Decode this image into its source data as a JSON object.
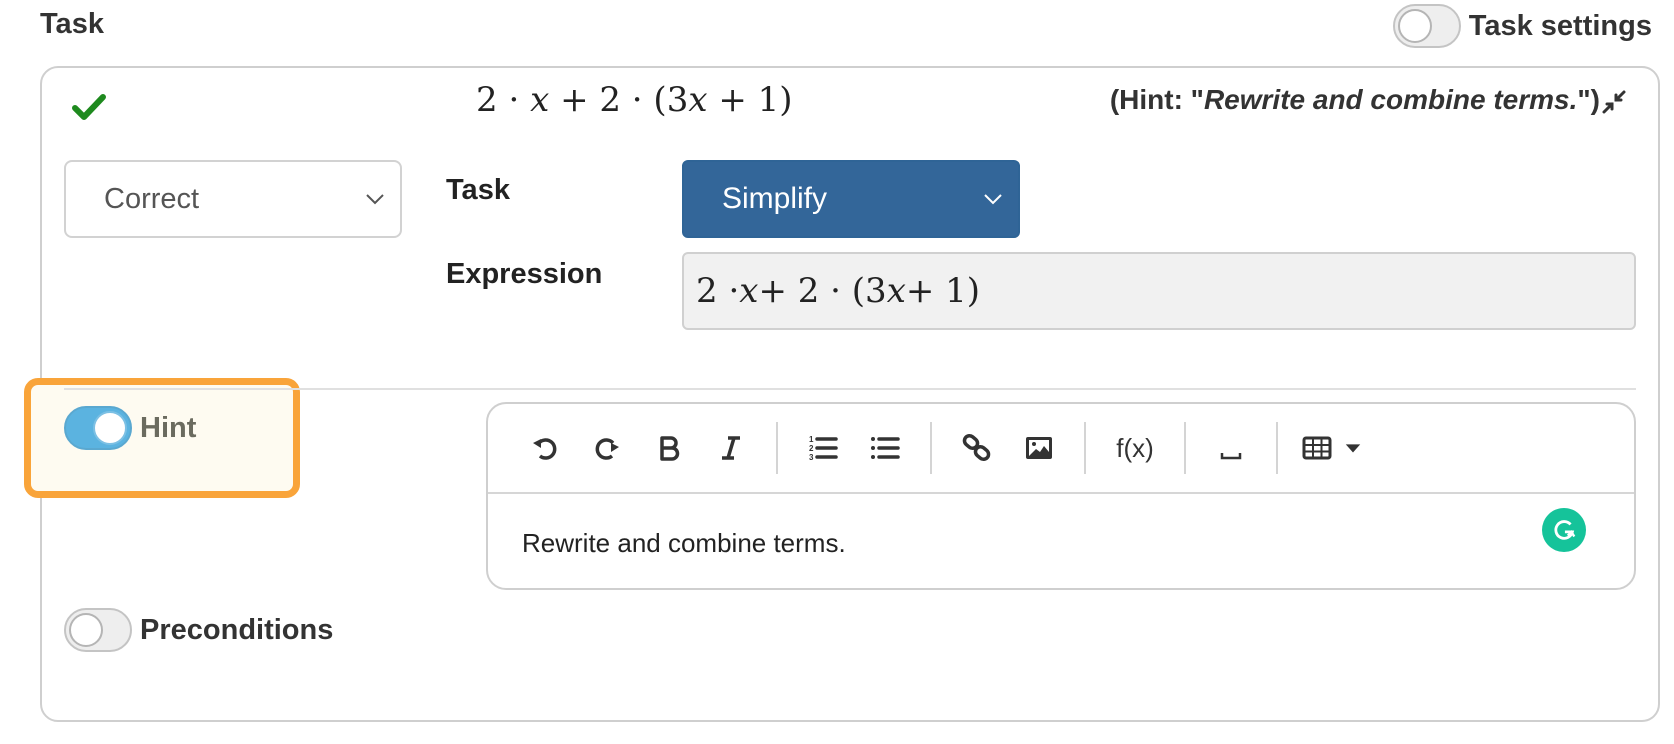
{
  "header": {
    "title": "Task",
    "task_settings_label": "Task settings",
    "task_settings_enabled": false
  },
  "task_card": {
    "status_icon": "check-icon",
    "summary_expression": {
      "parts": [
        "2",
        " · ",
        "x",
        " + 2 · (3",
        "x",
        " + 1)"
      ]
    },
    "hint_summary": {
      "prefix": "(Hint: \"",
      "text": "Rewrite and combine terms.",
      "suffix": "\")"
    },
    "collapse_icon": "collapse-arrows-icon",
    "status_select": {
      "value": "Correct"
    },
    "task_label": "Task",
    "task_select": {
      "value": "Simplify",
      "bg_color": "#336699"
    },
    "expression_label": "Expression",
    "expression_input": {
      "parts": [
        "2 · ",
        "x",
        " + 2 · (3",
        "x",
        " + 1)"
      ]
    },
    "hint": {
      "label": "Hint",
      "enabled": true,
      "highlight_color": "#f9a43a",
      "toggle_color": "#5bb3e0"
    },
    "editor": {
      "toolbar": [
        {
          "name": "undo-button",
          "icon": "undo-icon"
        },
        {
          "name": "redo-button",
          "icon": "redo-icon"
        },
        {
          "name": "bold-button",
          "icon": "bold-icon"
        },
        {
          "name": "italic-button",
          "icon": "italic-icon"
        },
        {
          "name": "ordered-list-button",
          "icon": "ordered-list-icon"
        },
        {
          "name": "bullet-list-button",
          "icon": "bullet-list-icon"
        },
        {
          "name": "link-button",
          "icon": "link-icon"
        },
        {
          "name": "image-button",
          "icon": "image-icon"
        },
        {
          "name": "formula-button",
          "label": "f(x)"
        },
        {
          "name": "nonbreaking-space-button",
          "label": "⎵"
        },
        {
          "name": "table-button",
          "icon": "table-icon"
        }
      ],
      "content": "Rewrite and combine terms.",
      "grammarly_letter": "G",
      "grammarly_color": "#15c39a"
    },
    "preconditions": {
      "label": "Preconditions",
      "enabled": false
    }
  }
}
